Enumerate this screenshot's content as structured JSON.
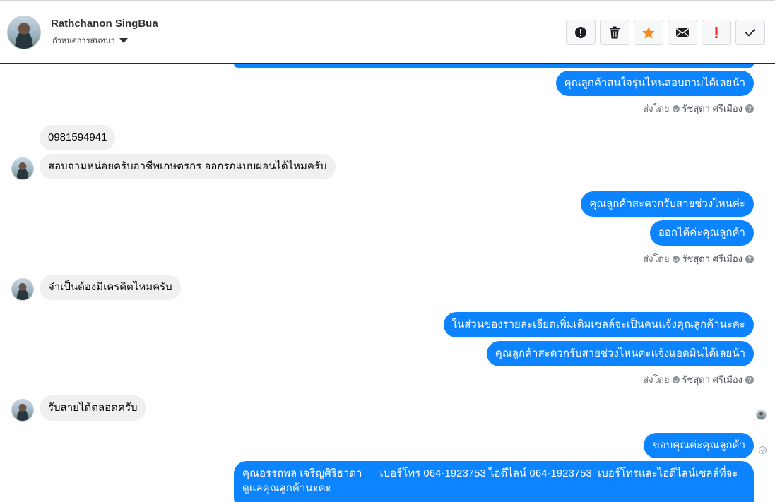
{
  "header": {
    "contact_name": "Rathchanon SingBua",
    "assign_label": "กำหนดการสนทนา",
    "actions": [
      {
        "icon": "alert-circle-icon",
        "color": "#1c1e21"
      },
      {
        "icon": "trash-icon",
        "color": "#1c1e21"
      },
      {
        "icon": "star-icon",
        "color": "#f28c28"
      },
      {
        "icon": "envelope-icon",
        "color": "#1c1e21"
      },
      {
        "icon": "exclamation-icon",
        "color": "#e4251b"
      },
      {
        "icon": "check-icon",
        "color": "#1c1e21"
      }
    ]
  },
  "colors": {
    "outgoing_bubble": "#0d84ff",
    "incoming_bubble": "#f0f0f0"
  },
  "messages": {
    "out_1": "คุณลูกค้าสนใจรุ่นไหนสอบถามได้เลยน้า",
    "sent_by_1": {
      "prefix": "ส่งโดย",
      "sender": "รัชสุดา ศรีเมือง"
    },
    "in_1": "0981594941",
    "in_2": "สอบถามหน่อยครับอาชีพเกษตรกร ออกรถแบบผ่อนได้ไหมครับ",
    "out_2": "คุณลูกค้าสะดวกรับสายช่วงไหนค่ะ",
    "out_3": "ออกได้ค่ะคุณลูกค้า",
    "sent_by_2": {
      "prefix": "ส่งโดย",
      "sender": "รัชสุดา ศรีเมือง"
    },
    "in_3": "จำเป็นต้องมีเครดิตไหมครับ",
    "out_4": "ในส่วนของรายละเอียดเพิ่มเติมเซลล์จะเป็นคนแจ้งคุณลูกค้านะคะ",
    "out_5": "คุณลูกค้าสะดวกรับสายช่วงไหนค่ะแจ้งแอดมินได้เลยน้า",
    "sent_by_3": {
      "prefix": "ส่งโดย",
      "sender": "รัชสุดา ศรีเมือง"
    },
    "in_4": "รับสายได้ตลอดครับ",
    "out_6": "ขอบคุณค่ะคุณลูกค้า",
    "out_7": "คุณอรรถพล เจริญศิริธาดา      เบอร์โทร 064-1923753 ไอดีไลน์ 064-1923753  เบอร์โทรและไอดีไลน์เซลล์ที่จะดูแลคุณลูกค้านะคะ"
  }
}
